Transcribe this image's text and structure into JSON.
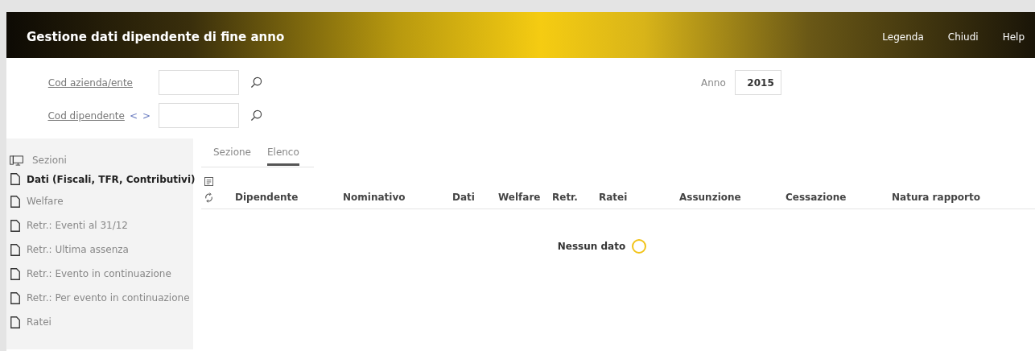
{
  "header": {
    "title": "Gestione dati dipendente di fine anno",
    "links": [
      "Legenda",
      "Chiudi",
      "Help"
    ]
  },
  "form": {
    "company_label": "Cod azienda/ente",
    "employee_label": "Cod dipendente",
    "prev": "<",
    "next": ">",
    "year_label": "Anno",
    "year_value": "2015"
  },
  "sidebar": {
    "title": "Sezioni",
    "items": [
      {
        "label": "Dati (Fiscali, TFR, Contributivi)",
        "selected": true
      },
      {
        "label": "Welfare",
        "selected": false
      },
      {
        "label": "Retr.: Eventi al 31/12",
        "selected": false
      },
      {
        "label": "Retr.: Ultima assenza",
        "selected": false
      },
      {
        "label": "Retr.: Evento in continuazione",
        "selected": false
      },
      {
        "label": "Retr.: Per evento in continuazione",
        "selected": false
      },
      {
        "label": "Ratei",
        "selected": false
      }
    ]
  },
  "tabs": [
    {
      "label": "Sezione",
      "selected": false
    },
    {
      "label": "Elenco",
      "selected": true
    }
  ],
  "table": {
    "columns": [
      "Dipendente",
      "Nominativo",
      "Dati",
      "Welfare",
      "Retr.",
      "Ratei",
      "Assunzione",
      "Cessazione",
      "Natura rapporto"
    ],
    "empty": "Nessun dato"
  }
}
